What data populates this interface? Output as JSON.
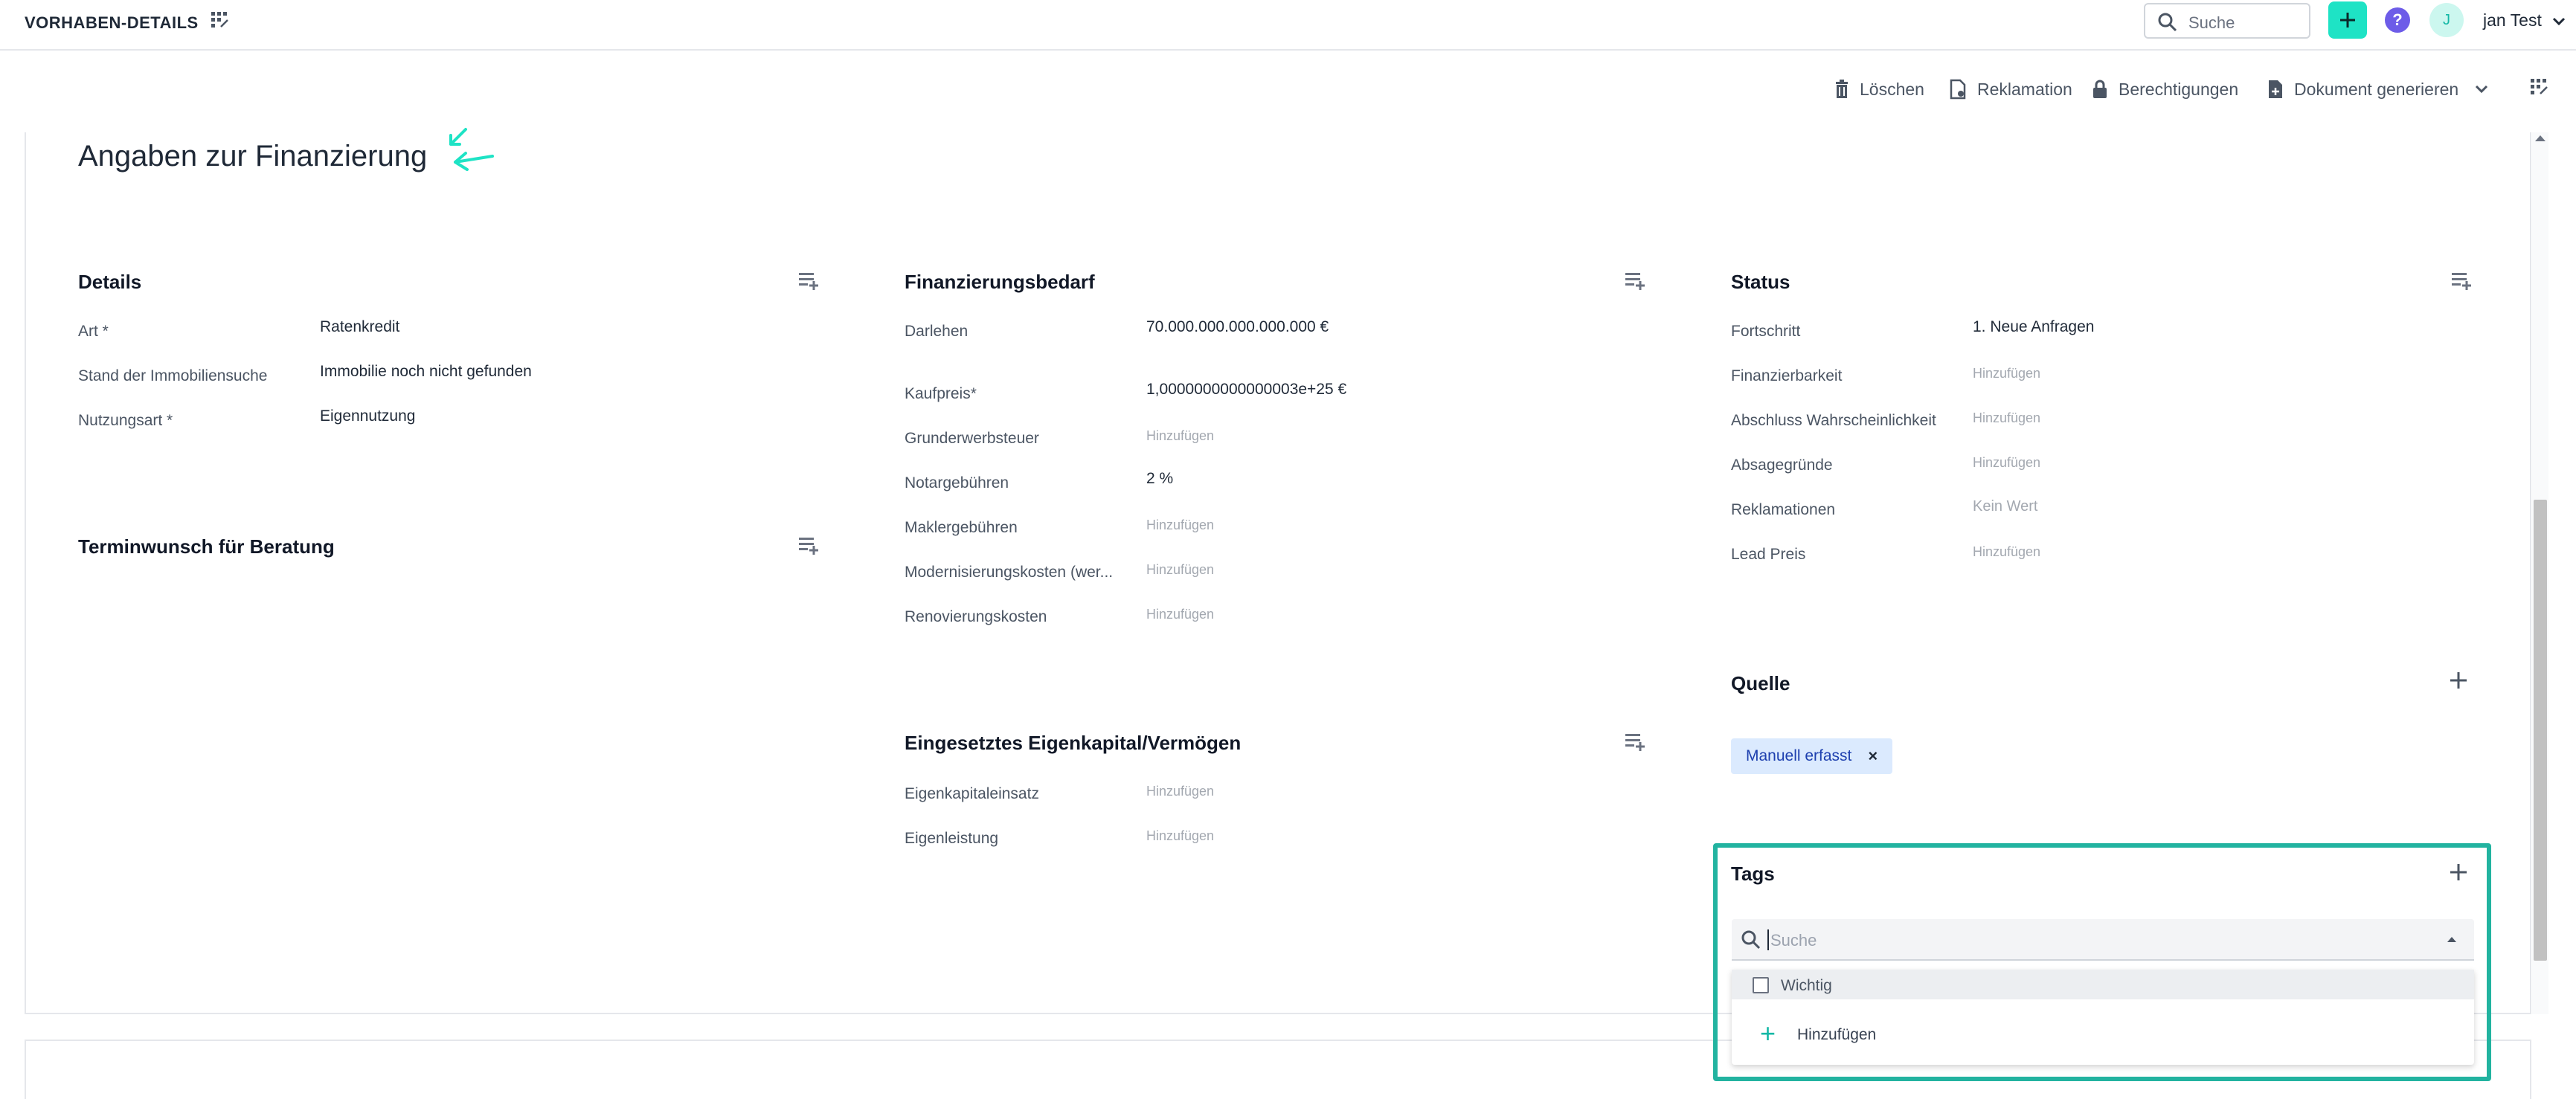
{
  "topbar": {
    "title": "VORHABEN-DETAILS",
    "search_placeholder": "Suche",
    "avatar_initial": "J",
    "user_name": "jan Test",
    "help_glyph": "?"
  },
  "actions": {
    "delete": "Löschen",
    "complaint": "Reklamation",
    "permissions": "Berechtigungen",
    "generate": "Dokument generieren"
  },
  "page": {
    "heading": "Angaben zur Finanzierung"
  },
  "details": {
    "title": "Details",
    "fields": [
      {
        "label": "Art *",
        "value": "Ratenkredit"
      },
      {
        "label": "Stand der Immobiliensuche",
        "value": "Immobilie noch nicht gefunden"
      },
      {
        "label": "Nutzungsart *",
        "value": "Eigennutzung"
      }
    ]
  },
  "appointment": {
    "title": "Terminwunsch für Beratung"
  },
  "financing": {
    "title": "Finanzierungsbedarf",
    "fields": [
      {
        "label": "Darlehen",
        "value": "70.000.000.000.000.000 €"
      },
      {
        "label": "Kaufpreis*",
        "value": "1,0000000000000003e+25 €"
      },
      {
        "label": "Grunderwerbsteuer",
        "value": "Hinzufügen"
      },
      {
        "label": "Notargebühren",
        "value": "2 %"
      },
      {
        "label": "Maklergebühren",
        "value": "Hinzufügen"
      },
      {
        "label": "Modernisierungskosten (wer...",
        "value": "Hinzufügen"
      },
      {
        "label": "Renovierungskosten",
        "value": "Hinzufügen"
      }
    ]
  },
  "equity": {
    "title": "Eingesetztes Eigenkapital/Vermögen",
    "fields": [
      {
        "label": "Eigenkapitaleinsatz",
        "value": "Hinzufügen"
      },
      {
        "label": "Eigenleistung",
        "value": "Hinzufügen"
      }
    ]
  },
  "status": {
    "title": "Status",
    "fields": [
      {
        "label": "Fortschritt",
        "value": "1. Neue Anfragen"
      },
      {
        "label": "Finanzierbarkeit",
        "value": "Hinzufügen"
      },
      {
        "label": "Abschluss Wahrscheinlichkeit",
        "value": "Hinzufügen"
      },
      {
        "label": "Absagegründe",
        "value": "Hinzufügen"
      },
      {
        "label": "Reklamationen",
        "value": "Kein Wert"
      },
      {
        "label": "Lead Preis",
        "value": "Hinzufügen"
      }
    ]
  },
  "source": {
    "title": "Quelle",
    "chip": "Manuell erfasst",
    "chip_remove": "×"
  },
  "tags": {
    "title": "Tags",
    "search_placeholder": "Suche",
    "options": [
      {
        "label": "Wichtig",
        "checked": false
      }
    ],
    "add_label": "Hinzufügen"
  },
  "colors": {
    "accent": "#1ee3c5",
    "highlight_border": "#22b3a0",
    "chip_bg": "#dbeafe",
    "help": "#6d5ce8"
  }
}
